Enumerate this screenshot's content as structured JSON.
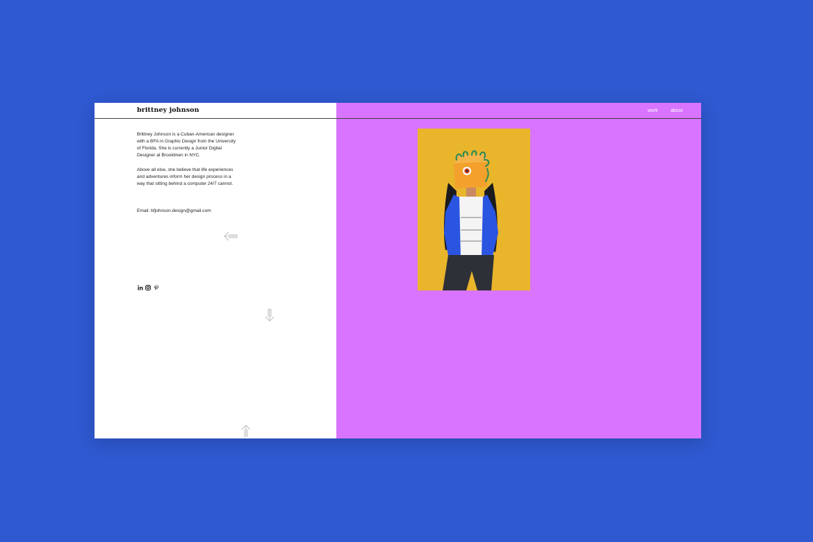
{
  "site": {
    "logo": "brittney johnson"
  },
  "nav": {
    "work": "work",
    "about": "about"
  },
  "bio": {
    "paragraph1": "Brittney Johnson is a Cuban-American designer with a BFA in Graphic Design from the University of Florida. She is currently a Junior Digital Designer at Brooklinen in NYC.",
    "paragraph2": "Above all else, she believe that life experiences and adventures inform her design process in a way that sitting behind a computer 24/7 cannot.",
    "email": "Email: bfjohnson.design@gmail.com"
  },
  "social": [
    "linkedin-icon",
    "instagram-icon",
    "pinterest-icon"
  ],
  "icons": [
    "arrow-left-icon",
    "arrow-down-icon",
    "arrow-up-icon"
  ],
  "colors": {
    "backdrop": "#2f59d1",
    "panel_left": "#ffffff",
    "panel_right": "#d874ff",
    "photo_background": "#e9b52b",
    "jacket": "#2a55e0",
    "mask": "#f3a12c"
  }
}
